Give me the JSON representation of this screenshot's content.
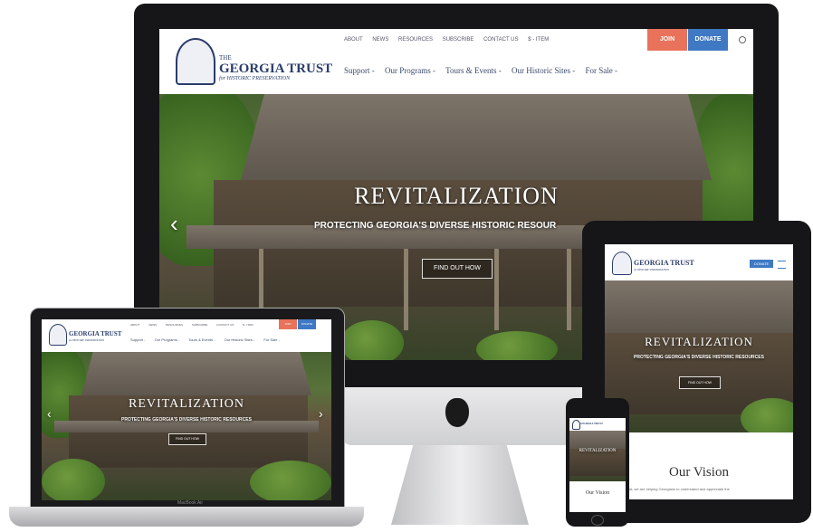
{
  "site": {
    "logo_small": "THE",
    "logo_main": "GEORGIA TRUST",
    "logo_sub": "for HISTORIC PRESERVATION",
    "top_links": [
      "ABOUT",
      "NEWS",
      "RESOURCES",
      "SUBSCRIBE",
      "CONTACT US",
      "$ - ITEM"
    ],
    "join_label": "JOIN",
    "donate_label": "DONATE",
    "main_nav": [
      "Support -",
      "Our Programs -",
      "Tours & Events -",
      "Our Historic Sites -",
      "For Sale -"
    ],
    "hero_title": "REVITALIZATION",
    "hero_subtitle": "PROTECTING GEORGIA'S DIVERSE HISTORIC RESOURCES",
    "hero_subtitle_desktop": "PROTECTING GEORGIA'S DIVERSE HISTORIC RESOUR",
    "cta_label": "FIND OUT HOW",
    "vision_heading": "Our Vision",
    "vision_text": "Georgia Trust, we are helping Georgians to understand and appreciate the"
  },
  "devices": {
    "laptop_label": "MacBook Air"
  },
  "colors": {
    "join": "#e8725a",
    "donate": "#3f79c4",
    "logo": "#2b3d6b",
    "bezel": "#1c1c1e"
  }
}
